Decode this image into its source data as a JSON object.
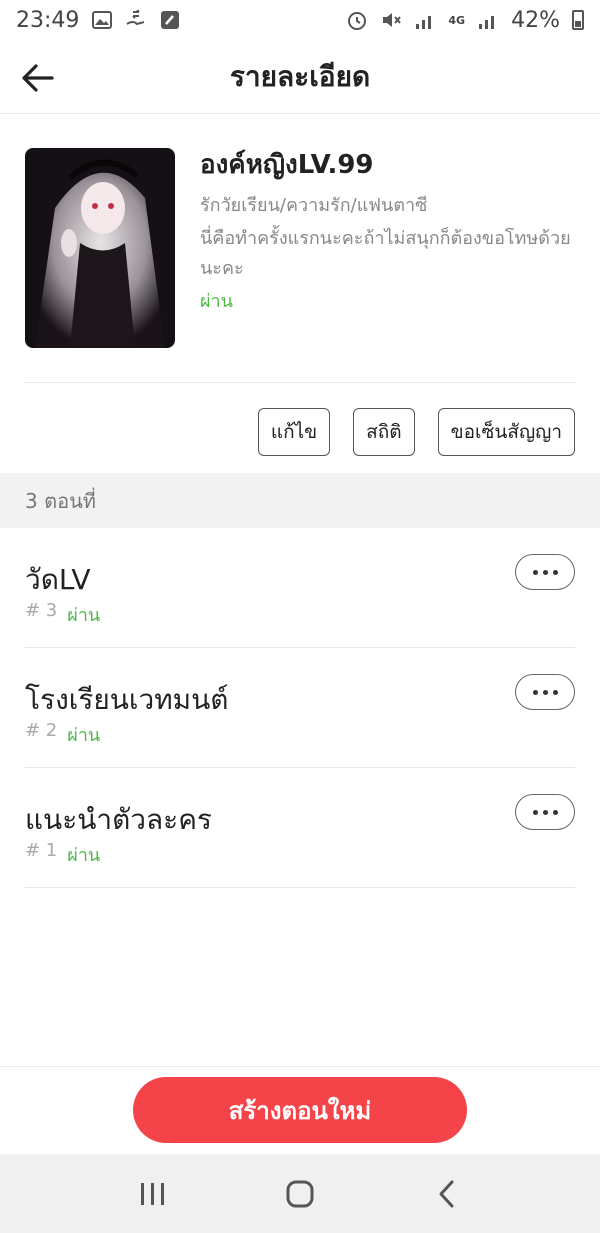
{
  "status_bar": {
    "time": "23:49",
    "network": "4G",
    "battery": "42%"
  },
  "header": {
    "title": "รายละเอียด"
  },
  "book": {
    "title": "องค์หญิงLV.99",
    "genre": "รักวัยเรียน/ความรัก/แฟนตาซี",
    "description": "นี่คือทำครั้งแรกนะคะถ้าไม่สนุกก็ต้องขอโทษด้วยนะคะ",
    "status": "ผ่าน"
  },
  "actions": {
    "edit_label": "แก้ไข",
    "stats_label": "สถิติ",
    "contract_label": "ขอเซ็นสัญญา"
  },
  "episodes_header": "3 ตอนที่",
  "episodes": [
    {
      "title": "วัดLV",
      "number": "# 3",
      "status": "ผ่าน"
    },
    {
      "title": "โรงเรียนเวทมนต์",
      "number": "# 2",
      "status": "ผ่าน"
    },
    {
      "title": "แนะนำตัวละคร",
      "number": "# 1",
      "status": "ผ่าน"
    }
  ],
  "create_button": "สร้างตอนใหม่",
  "colors": {
    "accent": "#f5434a",
    "status_green": "#4cb848"
  },
  "icons": {
    "back": "arrow-left-icon",
    "more": "ellipsis-icon",
    "nav_recents": "recents-icon",
    "nav_home": "home-icon",
    "nav_back": "back-chevron-icon"
  }
}
